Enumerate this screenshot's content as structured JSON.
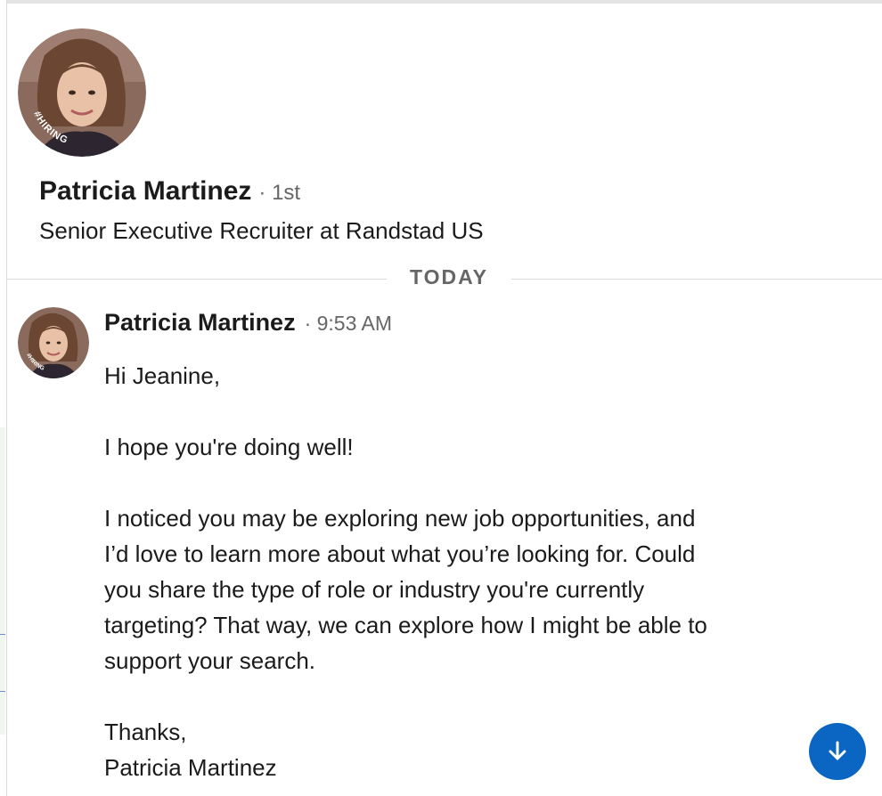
{
  "profile": {
    "name": "Patricia Martinez",
    "degree": "· 1st",
    "headline": "Senior Executive Recruiter at Randstad US",
    "avatar_badge": "#HIRING"
  },
  "divider": {
    "label": "TODAY"
  },
  "message": {
    "sender": "Patricia Martinez",
    "time": "· 9:53 AM",
    "avatar_badge": "#HIRING",
    "greeting": "Hi Jeanine,",
    "line1": "I hope you're doing well!",
    "paragraph_lines": [
      "I noticed you may be exploring new job opportunities, and",
      "I’d love to learn more about what you’re looking for. Could",
      "you share the type of role or industry you're currently",
      "targeting? That way, we can explore how I might be able to",
      "support your search."
    ],
    "closing": "Thanks,",
    "signature": "Patricia Martinez"
  },
  "scroll_button": {
    "icon": "arrow-down-icon"
  },
  "colors": {
    "accent": "#0a66c2",
    "hiring_ring": "#7b3fd9"
  }
}
